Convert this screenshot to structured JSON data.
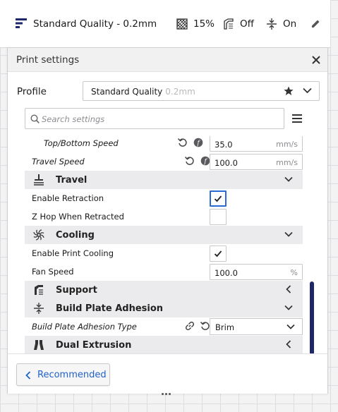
{
  "header": {
    "profile_name": "Standard Quality - 0.2mm",
    "infill": "15%",
    "support": "Off",
    "adhesion": "On"
  },
  "panel": {
    "title": "Print settings",
    "profile_label": "Profile",
    "profile_value": "Standard Quality",
    "profile_sub": "0.2mm",
    "search_placeholder": "Search settings",
    "recommended_label": "Recommended"
  },
  "settings": {
    "top_bottom_speed": {
      "label": "Top/Bottom Speed",
      "value": "35.0",
      "unit": "mm/s"
    },
    "travel_speed": {
      "label": "Travel Speed",
      "value": "100.0",
      "unit": "mm/s"
    },
    "travel_category": "Travel",
    "enable_retraction": {
      "label": "Enable Retraction",
      "checked": true
    },
    "z_hop": {
      "label": "Z Hop When Retracted",
      "checked": false
    },
    "cooling_category": "Cooling",
    "enable_cooling": {
      "label": "Enable Print Cooling",
      "checked": true
    },
    "fan_speed": {
      "label": "Fan Speed",
      "value": "100.0",
      "unit": "%"
    },
    "support_category": "Support",
    "adhesion_category": "Build Plate Adhesion",
    "adhesion_type": {
      "label": "Build Plate Adhesion Type",
      "value": "Brim"
    },
    "dual_category": "Dual Extrusion"
  },
  "colors": {
    "accent": "#2a6bd3",
    "link": "#1f62c9",
    "scrollbar": "#1e2769",
    "category_bg": "#ebebed"
  }
}
